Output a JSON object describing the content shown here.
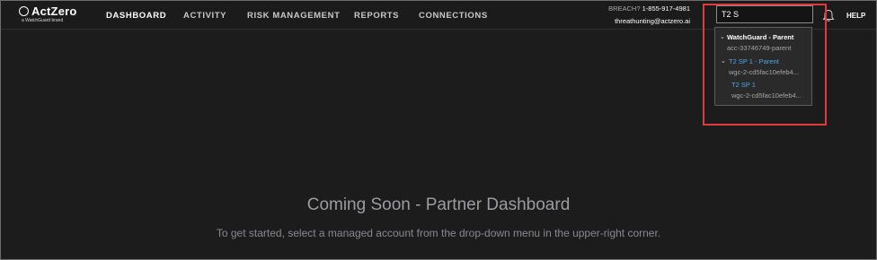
{
  "brand": {
    "name": "ActZero",
    "tagline": "a WatchGuard brand"
  },
  "nav": {
    "items": [
      {
        "label": "DASHBOARD",
        "active": true
      },
      {
        "label": "ACTIVITY",
        "active": false
      },
      {
        "label": "RISK MANAGEMENT",
        "active": false
      },
      {
        "label": "REPORTS",
        "active": false
      },
      {
        "label": "CONNECTIONS",
        "active": false
      }
    ]
  },
  "contact": {
    "breach_label": "BREACH?",
    "phone": "1-855-917-4981",
    "email": "threathunting@actzero.ai"
  },
  "search": {
    "value": "T2 S"
  },
  "icons": {
    "notifications": "bell-icon",
    "expand": "chevron-down-icon"
  },
  "help_label": "HELP",
  "dropdown": {
    "items": [
      {
        "title": "WatchGuard - Parent",
        "subtitle": "acc-33746749-parent"
      },
      {
        "title": "T2 SP 1 - Parent",
        "subtitle": "wgc-2-cd5fac10efeb4..."
      },
      {
        "title": "T2 SP 1",
        "subtitle": "wgc-2-cd5fac10efeb4..."
      }
    ]
  },
  "main": {
    "title": "Coming Soon - Partner Dashboard",
    "subtitle": "To get started, select a managed account from the drop-down menu in the upper-right corner."
  },
  "colors": {
    "background": "#1c1c1d",
    "highlight": "#e0393e",
    "match": "#4ea7e6"
  }
}
